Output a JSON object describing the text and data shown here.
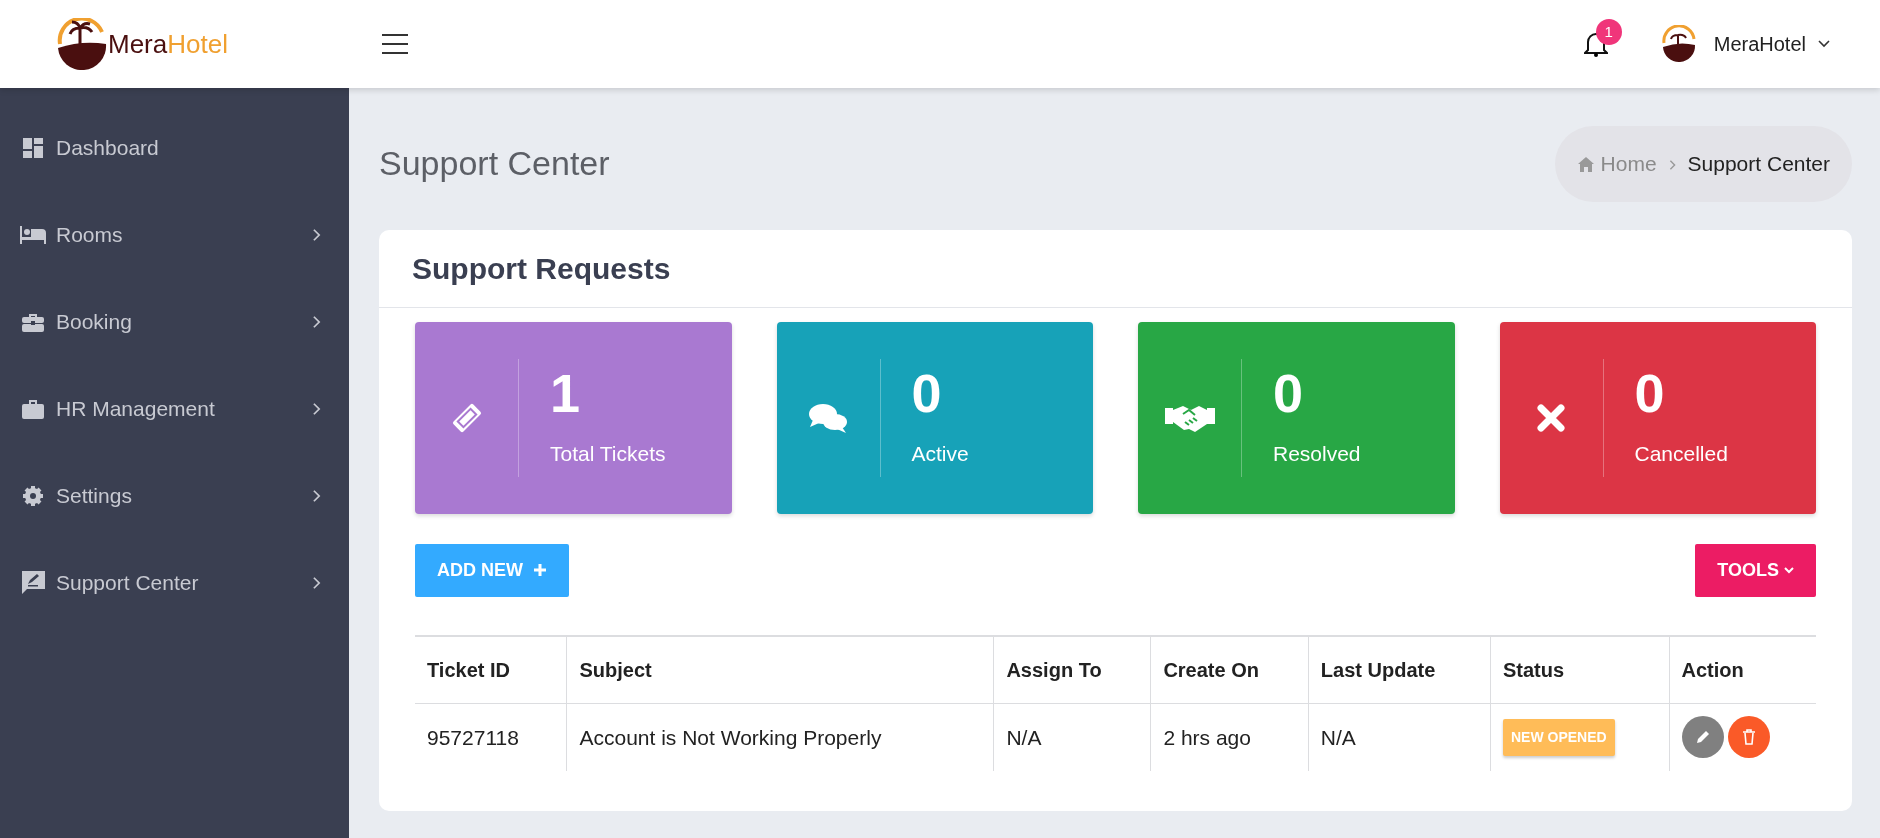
{
  "header": {
    "logo": {
      "part_1": "Mera",
      "part_2": "Hotel"
    },
    "notifications": {
      "count": "1"
    },
    "user": {
      "name": "MeraHotel"
    }
  },
  "sidebar": {
    "items": [
      {
        "label": "Dashboard",
        "kind": "dashboard",
        "expandable": false
      },
      {
        "label": "Rooms",
        "kind": "bed",
        "expandable": true
      },
      {
        "label": "Booking",
        "kind": "briefcase-plus",
        "expandable": true
      },
      {
        "label": "HR Management",
        "kind": "briefcase",
        "expandable": true
      },
      {
        "label": "Settings",
        "kind": "gear",
        "expandable": true
      },
      {
        "label": "Support Center",
        "kind": "chat-edit",
        "expandable": true
      }
    ]
  },
  "page": {
    "title": "Support Center",
    "breadcrumb": [
      {
        "label": "Home",
        "current": false
      },
      {
        "label": "Support Center",
        "current": true
      }
    ]
  },
  "panel": {
    "title": "Support Requests",
    "stats": [
      {
        "value": "1",
        "label": "Total Tickets",
        "kind": "ticket",
        "color": "#a979d1"
      },
      {
        "value": "0",
        "label": "Active",
        "kind": "chat",
        "color": "#17a2b8"
      },
      {
        "value": "0",
        "label": "Resolved",
        "kind": "handshake",
        "color": "#28a745"
      },
      {
        "value": "0",
        "label": "Cancelled",
        "kind": "cross",
        "color": "#dc3545"
      }
    ],
    "add_button": "ADD NEW",
    "tools_button": "TOOLS",
    "table": {
      "columns": [
        "Ticket ID",
        "Subject",
        "Assign To",
        "Create On",
        "Last Update",
        "Status",
        "Action"
      ],
      "rows": [
        {
          "ticket_id": "95727118",
          "subject": "Account is Not Working Properly",
          "assign_to": "N/A",
          "create_on": "2 hrs ago",
          "last_update": "N/A",
          "status": {
            "label": "NEW OPENED",
            "color": "#ffbc58"
          }
        }
      ]
    }
  }
}
